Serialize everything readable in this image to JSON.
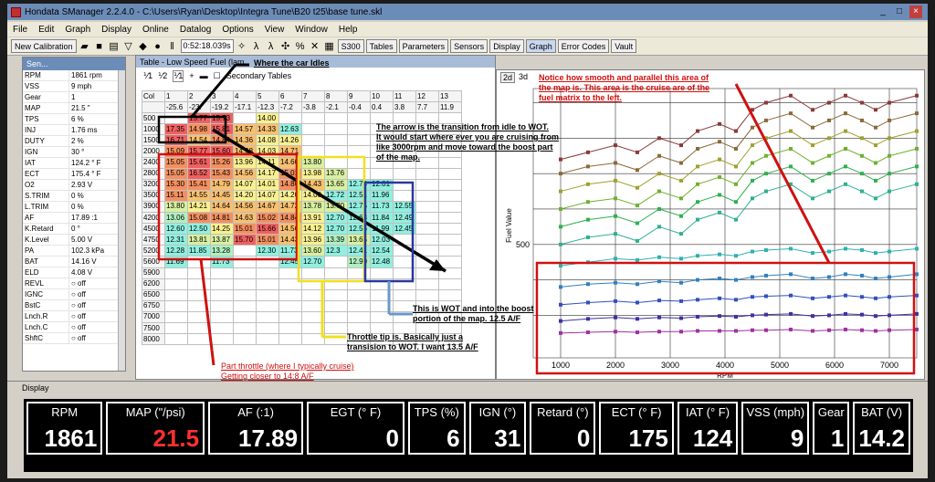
{
  "window": {
    "title": "Hondata SManager 2.2.4.0 - C:\\Users\\Ryan\\Desktop\\Integra Tune\\B20 t25\\base tune.skl"
  },
  "menu": [
    "File",
    "Edit",
    "Graph",
    "Display",
    "Online",
    "Datalog",
    "Options",
    "View",
    "Window",
    "Help"
  ],
  "toolbar": {
    "new_calibration": "New Calibration",
    "time": "0:52:18.039s",
    "buttons": [
      "S300",
      "Tables",
      "Parameters",
      "Sensors",
      "Display",
      "Graph",
      "Error Codes",
      "Vault"
    ]
  },
  "sensor_panel": {
    "title": "Sen...",
    "rows": [
      {
        "name": "RPM",
        "value": "1861 rpm"
      },
      {
        "name": "VSS",
        "value": "9 mph"
      },
      {
        "name": "Gear",
        "value": "1"
      },
      {
        "name": "MAP",
        "value": "21.5 \""
      },
      {
        "name": "TPS",
        "value": "6 %"
      },
      {
        "name": "INJ",
        "value": "1.76 ms"
      },
      {
        "name": "DUTY",
        "value": "2 %"
      },
      {
        "name": "IGN",
        "value": "30 °"
      },
      {
        "name": "IAT",
        "value": "124.2 ° F"
      },
      {
        "name": "ECT",
        "value": "175.4 ° F"
      },
      {
        "name": "O2",
        "value": "2.93 V"
      },
      {
        "name": "S.TRIM",
        "value": "0 %"
      },
      {
        "name": "L.TRIM",
        "value": "0 %"
      },
      {
        "name": "AF",
        "value": "17.89 :1"
      },
      {
        "name": "K.Retard",
        "value": "0 °"
      },
      {
        "name": "K.Level",
        "value": "5.00 V"
      },
      {
        "name": "PA",
        "value": "102.3 kPa"
      },
      {
        "name": "BAT",
        "value": "14.16 V"
      },
      {
        "name": "ELD",
        "value": "4.08 V"
      },
      {
        "name": "REVL",
        "value": "off"
      },
      {
        "name": "IGNC",
        "value": "off"
      },
      {
        "name": "BstC",
        "value": "off"
      },
      {
        "name": "Lnch.R",
        "value": "off"
      },
      {
        "name": "Lnch.C",
        "value": "off"
      },
      {
        "name": "ShftC",
        "value": "off"
      }
    ]
  },
  "table_window": {
    "title": "Table - Low Speed Fuel (lam",
    "secondary": "Secondary Tables",
    "col_header": "Col",
    "cols": [
      "1",
      "2",
      "3",
      "4",
      "5",
      "6",
      "7",
      "8",
      "9",
      "10",
      "11",
      "12",
      "13"
    ],
    "vals": [
      "-25.6",
      "-23.",
      "-19.2",
      "-17.1",
      "-12.3",
      "-7.2",
      "-3.8",
      "-2.1",
      "-0.4",
      "0.4",
      "3.8",
      "7.7",
      "11.9"
    ],
    "rows": [
      {
        "rpm": "500",
        "cells": [
          "",
          "15.77",
          "15.73",
          "",
          "14.00",
          "",
          "",
          "",
          "",
          "",
          "",
          "",
          ""
        ]
      },
      {
        "rpm": "1000",
        "cells": [
          "17.35",
          "14.98",
          "15.81",
          "14.57",
          "14.33",
          "12.63",
          "",
          "",
          "",
          "",
          "",
          "",
          ""
        ]
      },
      {
        "rpm": "1500",
        "cells": [
          "16.71",
          "14.54",
          "14.84",
          "14.36",
          "14.08",
          "14.26",
          "",
          "",
          "",
          "",
          "",
          "",
          ""
        ]
      },
      {
        "rpm": "2000",
        "cells": [
          "15.09",
          "15.77",
          "15.60",
          "14.58",
          "14.03",
          "14.71",
          "",
          "",
          "",
          "",
          "",
          "",
          ""
        ]
      },
      {
        "rpm": "2400",
        "cells": [
          "15.05",
          "15.61",
          "15.26",
          "13.96",
          "14.11",
          "14.60",
          "13.80",
          "",
          "",
          "",
          "",
          "",
          ""
        ]
      },
      {
        "rpm": "2800",
        "cells": [
          "15.05",
          "16.52",
          "15.43",
          "14.56",
          "14.17",
          "15.01",
          "13.98",
          "13.76",
          "",
          "",
          "",
          "",
          ""
        ]
      },
      {
        "rpm": "3200",
        "cells": [
          "15.30",
          "15.41",
          "14.79",
          "14.07",
          "14.01",
          "14.86",
          "14.43",
          "13.65",
          "12.74",
          "12.01",
          "",
          "",
          ""
        ]
      },
      {
        "rpm": "3500",
        "cells": [
          "15.11",
          "14.55",
          "14.45",
          "14.20",
          "14.07",
          "14.20",
          "14.00",
          "12.72",
          "12.51",
          "11.96",
          "",
          "",
          ""
        ]
      },
      {
        "rpm": "3900",
        "cells": [
          "13.80",
          "14.21",
          "14.64",
          "14.56",
          "14.67",
          "14.72",
          "13.78",
          "13.70",
          "12.75",
          "11.73",
          "12.55",
          "",
          ""
        ]
      },
      {
        "rpm": "4200",
        "cells": [
          "13.06",
          "15.08",
          "14.81",
          "14.63",
          "15.02",
          "14.84",
          "13.91",
          "12.70",
          "12.63",
          "11.84",
          "12.49",
          "",
          ""
        ]
      },
      {
        "rpm": "4500",
        "cells": [
          "12.60",
          "12.50",
          "14.25",
          "15.01",
          "15.66",
          "14.56",
          "14.12",
          "12.70",
          "12.56",
          "11.99",
          "12.45",
          "",
          ""
        ]
      },
      {
        "rpm": "4750",
        "cells": [
          "12.31",
          "13.81",
          "13.87",
          "15.70",
          "15.01",
          "14.43",
          "13.96",
          "13.39",
          "13.65",
          "12.03",
          "",
          "",
          ""
        ]
      },
      {
        "rpm": "5200",
        "cells": [
          "12.28",
          "11.85",
          "13.28",
          "",
          "12.30",
          "11.73",
          "13.60",
          "12.3",
          "12.41",
          "12.54",
          "",
          "",
          ""
        ]
      },
      {
        "rpm": "5600",
        "cells": [
          "11.69",
          "",
          "11.73",
          "",
          "",
          "12.45",
          "12.70",
          "",
          "12.90",
          "12.48",
          "",
          "",
          ""
        ]
      },
      {
        "rpm": "5900",
        "cells": [
          "",
          "",
          "",
          "",
          "",
          "",
          "",
          "",
          "",
          "",
          "",
          "",
          ""
        ]
      },
      {
        "rpm": "6200",
        "cells": [
          "",
          "",
          "",
          "",
          "",
          "",
          "",
          "",
          "",
          "",
          "",
          "",
          ""
        ]
      },
      {
        "rpm": "6500",
        "cells": [
          "",
          "",
          "",
          "",
          "",
          "",
          "",
          "",
          "",
          "",
          "",
          "",
          ""
        ]
      },
      {
        "rpm": "6750",
        "cells": [
          "",
          "",
          "",
          "",
          "",
          "",
          "",
          "",
          "",
          "",
          "",
          "",
          ""
        ]
      },
      {
        "rpm": "7000",
        "cells": [
          "",
          "",
          "",
          "",
          "",
          "",
          "",
          "",
          "",
          "",
          "",
          "",
          ""
        ]
      },
      {
        "rpm": "7500",
        "cells": [
          "",
          "",
          "",
          "",
          "",
          "",
          "",
          "",
          "",
          "",
          "",
          "",
          ""
        ]
      },
      {
        "rpm": "8000",
        "cells": [
          "",
          "",
          "",
          "",
          "",
          "",
          "",
          "",
          "",
          "",
          "",
          "",
          ""
        ]
      }
    ]
  },
  "graph": {
    "tabs": [
      "2d",
      "3d"
    ],
    "ylabel": "Fuel Value",
    "xlabel": "RPM",
    "ytick": "500",
    "xticks": [
      "1000",
      "2000",
      "3000",
      "4000",
      "5000",
      "6000",
      "7000"
    ]
  },
  "chart_data": {
    "type": "line",
    "xlabel": "RPM",
    "ylabel": "Fuel Value",
    "x": [
      1000,
      1500,
      2000,
      2400,
      2800,
      3200,
      3500,
      3900,
      4200,
      4500,
      4750,
      5200,
      5600,
      5900,
      6200,
      6500,
      6750,
      7000,
      7500
    ],
    "series": [
      {
        "color": "#8b3a3a",
        "values": [
          620,
          630,
          640,
          630,
          650,
          640,
          660,
          670,
          660,
          690,
          700,
          710,
          690,
          700,
          710,
          700,
          690,
          700,
          710
        ]
      },
      {
        "color": "#8b6a3a",
        "values": [
          600,
          610,
          615,
          605,
          625,
          615,
          635,
          645,
          635,
          665,
          675,
          685,
          665,
          675,
          685,
          675,
          665,
          675,
          685
        ]
      },
      {
        "color": "#a0a030",
        "values": [
          575,
          585,
          590,
          580,
          600,
          590,
          610,
          620,
          610,
          640,
          650,
          660,
          640,
          650,
          660,
          650,
          640,
          650,
          660
        ]
      },
      {
        "color": "#70b030",
        "values": [
          550,
          560,
          565,
          555,
          575,
          565,
          585,
          595,
          585,
          615,
          625,
          635,
          615,
          625,
          635,
          625,
          615,
          625,
          635
        ]
      },
      {
        "color": "#30b050",
        "values": [
          525,
          535,
          540,
          530,
          550,
          540,
          560,
          570,
          560,
          590,
          600,
          610,
          590,
          600,
          610,
          600,
          590,
          600,
          610
        ]
      },
      {
        "color": "#30b090",
        "values": [
          500,
          510,
          515,
          505,
          525,
          515,
          535,
          545,
          535,
          565,
          575,
          585,
          565,
          575,
          585,
          575,
          565,
          575,
          585
        ]
      },
      {
        "color": "#30b0b0",
        "values": [
          470,
          475,
          480,
          478,
          482,
          480,
          484,
          486,
          484,
          490,
          492,
          494,
          488,
          490,
          494,
          492,
          488,
          490,
          494
        ]
      },
      {
        "color": "#3080c0",
        "values": [
          440,
          444,
          446,
          444,
          448,
          446,
          450,
          452,
          450,
          454,
          456,
          458,
          452,
          454,
          458,
          456,
          452,
          454,
          458
        ]
      },
      {
        "color": "#3050c0",
        "values": [
          415,
          418,
          420,
          418,
          421,
          420,
          422,
          424,
          422,
          426,
          427,
          428,
          424,
          426,
          428,
          426,
          424,
          426,
          428
        ]
      },
      {
        "color": "#4030a0",
        "values": [
          392,
          395,
          397,
          395,
          397,
          396,
          398,
          399,
          398,
          400,
          401,
          402,
          399,
          400,
          402,
          401,
          399,
          400,
          402
        ]
      },
      {
        "color": "#a030a0",
        "values": [
          375,
          376,
          377,
          376,
          377,
          377,
          378,
          378,
          378,
          379,
          379,
          380,
          378,
          379,
          380,
          379,
          378,
          379,
          380
        ]
      }
    ]
  },
  "annotations": {
    "idle": "Where the car Idles",
    "arrow": [
      "The arrow is the transition from idle to WOT.",
      "It would start where ever you are cruising from",
      "like 3000rpm and move toward the boost part",
      "of the map."
    ],
    "cruise": [
      "Notice how smooth and parallel this area of",
      "the map is. This area is the cruise are of the",
      "fuel matrix to the left."
    ],
    "wot": [
      "This is WOT and into the boost",
      "portion of the map.  12.5 A/F"
    ],
    "tip": [
      "Throttle tip is. Basically just a",
      "transision to WOT. I want 13.5 A/F"
    ],
    "part": [
      "Part throttle (where I typically cruise)",
      "Getting closer to 14:8 A/F"
    ]
  },
  "display": {
    "title": "Display",
    "gauges": [
      {
        "label": "RPM",
        "value": "1861",
        "warn": false
      },
      {
        "label": "MAP (\"/psi)",
        "value": "21.5",
        "warn": true
      },
      {
        "label": "AF (:1)",
        "value": "17.89",
        "warn": false
      },
      {
        "label": "EGT (° F)",
        "value": "0",
        "warn": false
      },
      {
        "label": "TPS (%)",
        "value": "6",
        "warn": false
      },
      {
        "label": "IGN (°)",
        "value": "31",
        "warn": false
      },
      {
        "label": "Retard (°)",
        "value": "0",
        "warn": false
      },
      {
        "label": "ECT (° F)",
        "value": "175",
        "warn": false
      },
      {
        "label": "IAT (° F)",
        "value": "124",
        "warn": false
      },
      {
        "label": "VSS (mph)",
        "value": "9",
        "warn": false
      },
      {
        "label": "Gear",
        "value": "1",
        "warn": false
      },
      {
        "label": "BAT (V)",
        "value": "14.2",
        "warn": false
      }
    ]
  }
}
